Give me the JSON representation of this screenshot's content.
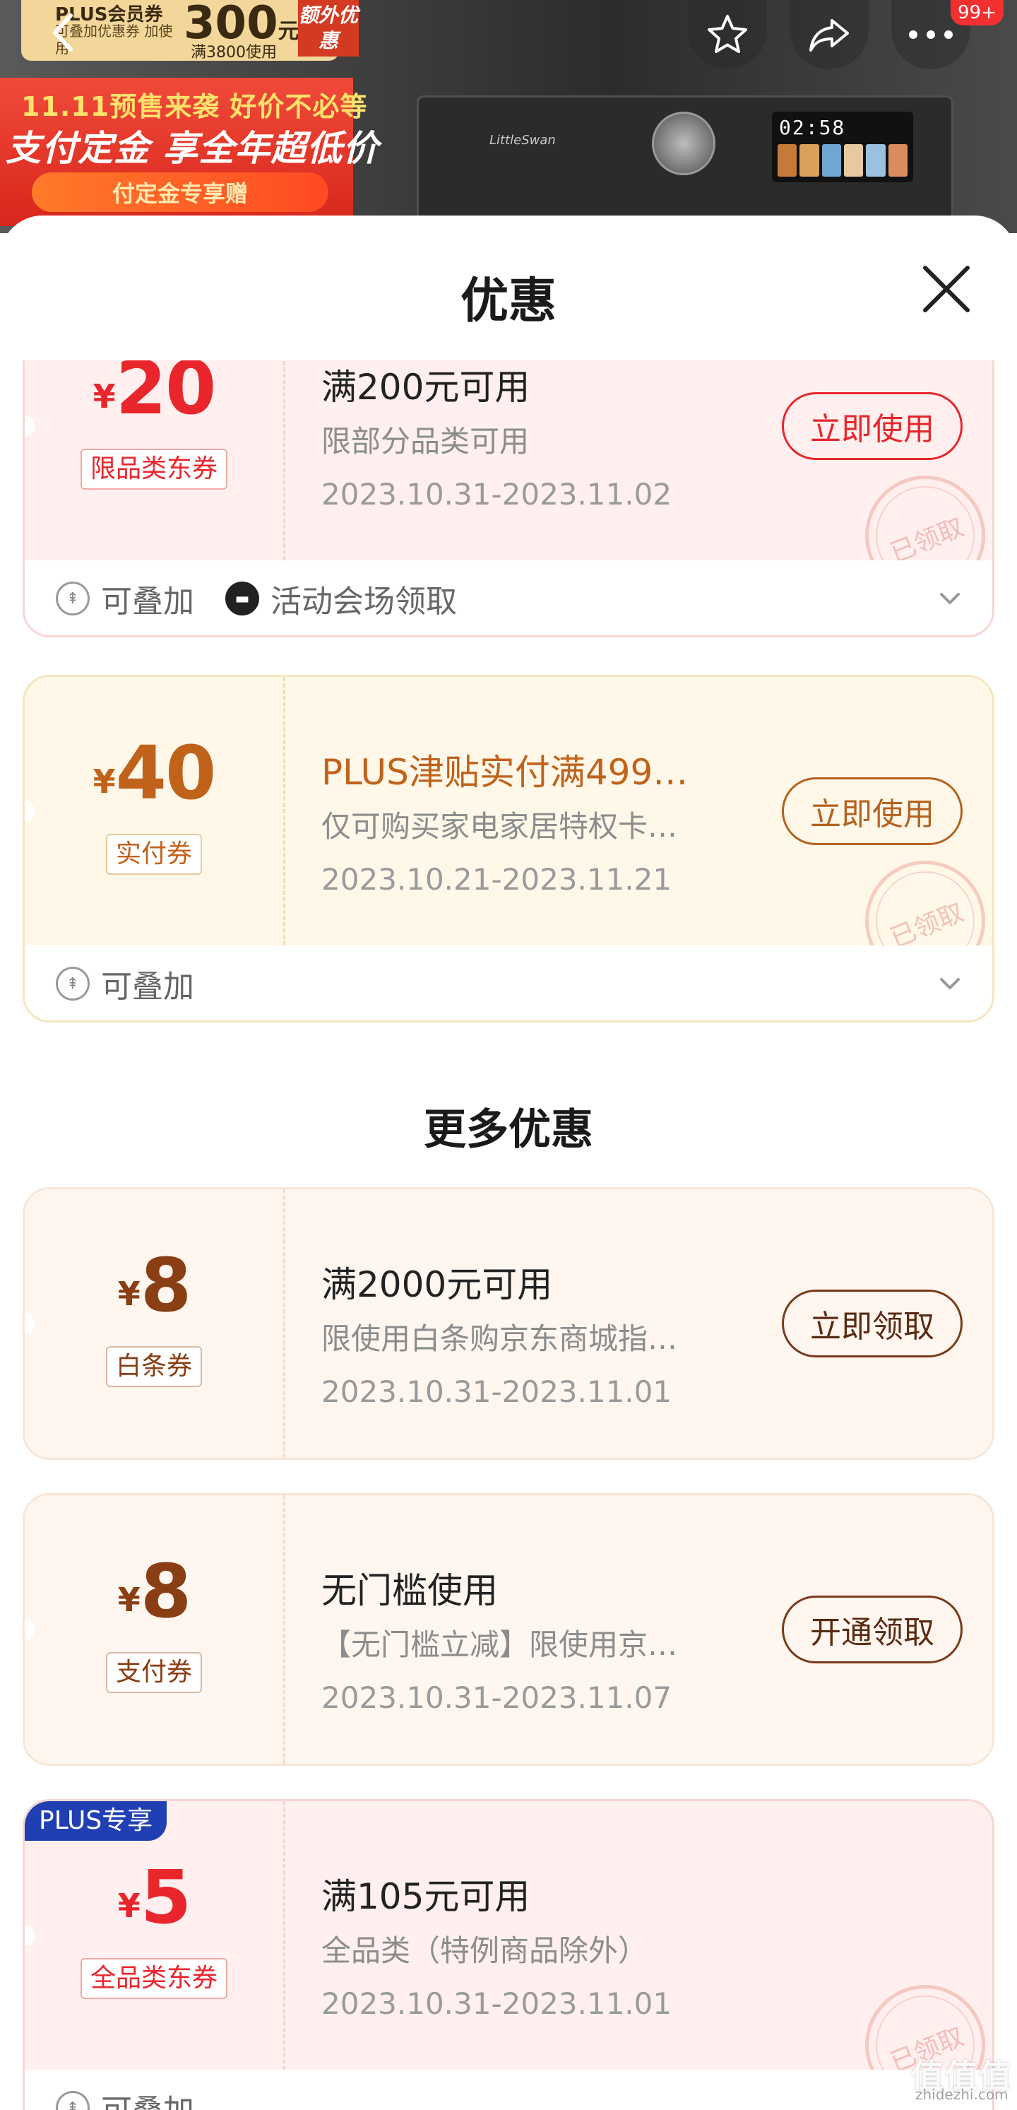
{
  "header": {
    "plus_tag": "PLUS会员券",
    "plus_sub": "可叠加优惠券 加使用",
    "plus_amount": "300",
    "plus_unit": "元",
    "plus_condition": "满3800使用",
    "plus_extra": "额外优惠",
    "notification_count": "99+"
  },
  "promo": {
    "line1": "11.11预售来袭 好价不必等",
    "line2": "支付定金 享全年超低价",
    "button": "付定金专享赠"
  },
  "washer": {
    "brand": "LittleSwan",
    "time": "02:58"
  },
  "sheet": {
    "title": "优惠"
  },
  "coupons": [
    {
      "yen": "¥",
      "amount": "20",
      "tag": "限品类东券",
      "title": "满200元可用",
      "desc": "限部分品类可用",
      "date": "2023.10.31-2023.11.02",
      "action": "立即使用",
      "stamp": "已领取",
      "footer": [
        "可叠加",
        "活动会场领取"
      ]
    },
    {
      "yen": "¥",
      "amount": "40",
      "tag": "实付券",
      "title": "PLUS津贴实付满499…",
      "desc": "仅可购买家电家居特权卡…",
      "date": "2023.10.21-2023.11.21",
      "action": "立即使用",
      "stamp": "已领取",
      "footer": [
        "可叠加"
      ]
    }
  ],
  "more_title": "更多优惠",
  "more_coupons": [
    {
      "yen": "¥",
      "amount": "8",
      "tag": "白条券",
      "title": "满2000元可用",
      "desc": "限使用白条购京东商城指…",
      "date": "2023.10.31-2023.11.01",
      "action": "立即领取"
    },
    {
      "yen": "¥",
      "amount": "8",
      "tag": "支付券",
      "title": "无门槛使用",
      "desc": "【无门槛立减】限使用京…",
      "date": "2023.10.31-2023.11.07",
      "action": "开通领取"
    },
    {
      "badge": "PLUS专享",
      "yen": "¥",
      "amount": "5",
      "tag": "全品类东券",
      "title": "满105元可用",
      "desc": "全品类（特例商品除外）",
      "date": "2023.10.31-2023.11.01",
      "stamp": "已领取",
      "footer": [
        "可叠加"
      ]
    }
  ],
  "watermark": {
    "main": "值值值",
    "sub": "zhidezhi.com"
  },
  "colors": {
    "red": "#e8262c",
    "gold": "#c1621b",
    "brown": "#8a3e14",
    "plus_blue": "#1f3fb3"
  }
}
